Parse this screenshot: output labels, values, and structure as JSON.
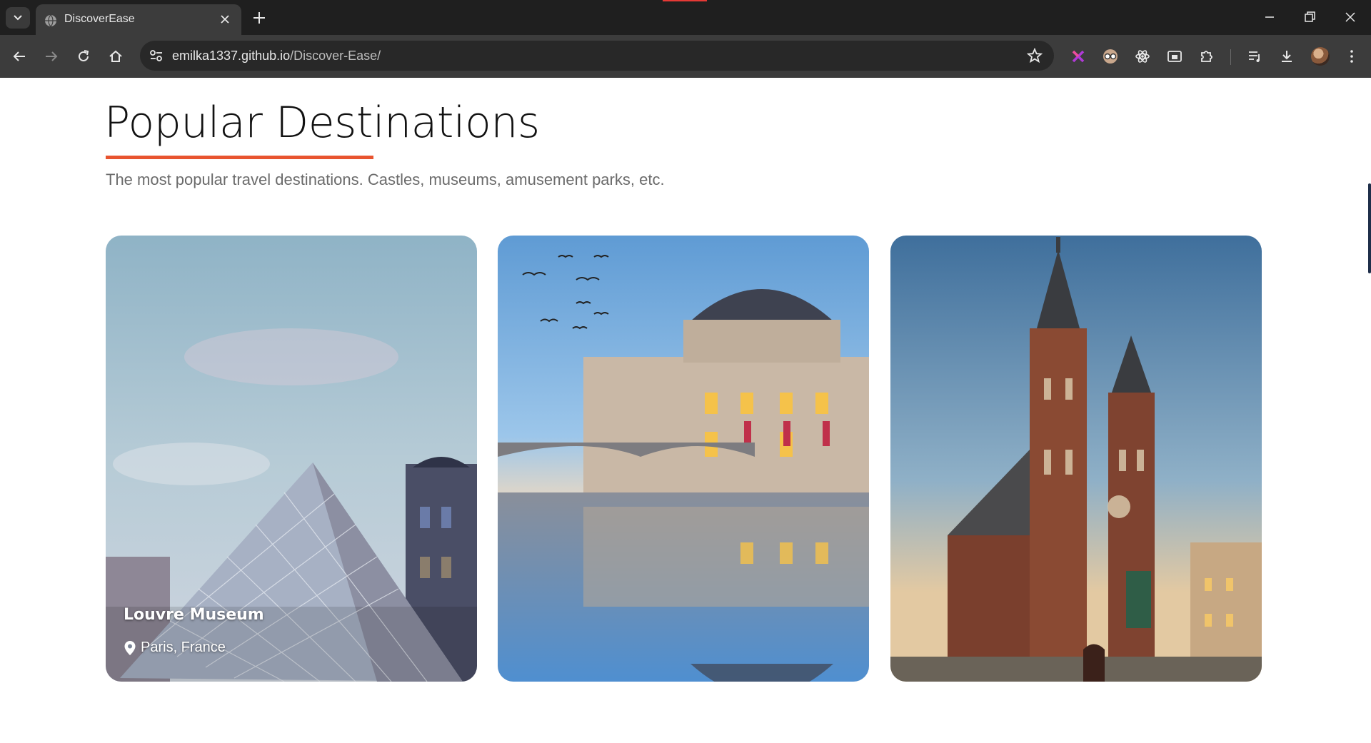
{
  "browser": {
    "tab_title": "DiscoverEase",
    "url_host": "emilka1337.github.io",
    "url_path": "/Discover-Ease/",
    "icons": [
      "tab-list-icon",
      "globe-icon",
      "close-icon",
      "plus-icon",
      "minimize-icon",
      "restore-icon",
      "window-close-icon",
      "back-icon",
      "forward-icon",
      "reload-icon",
      "home-icon",
      "site-info-icon",
      "star-icon",
      "extension-x-icon",
      "extension-glasses-icon",
      "extension-atom-icon",
      "picture-in-picture-icon",
      "puzzle-icon",
      "media-queue-icon",
      "download-icon",
      "avatar"
    ]
  },
  "section": {
    "title": "Popular Destinations",
    "subtitle": "The most popular travel destinations. Castles, museums, amusement parks, etc.",
    "accent_color": "#e8542f"
  },
  "cards": [
    {
      "name": "Louvre Museum",
      "location": "Paris, France",
      "icon": "location-pin-icon"
    },
    {
      "name": "",
      "location": ""
    },
    {
      "name": "",
      "location": ""
    }
  ]
}
